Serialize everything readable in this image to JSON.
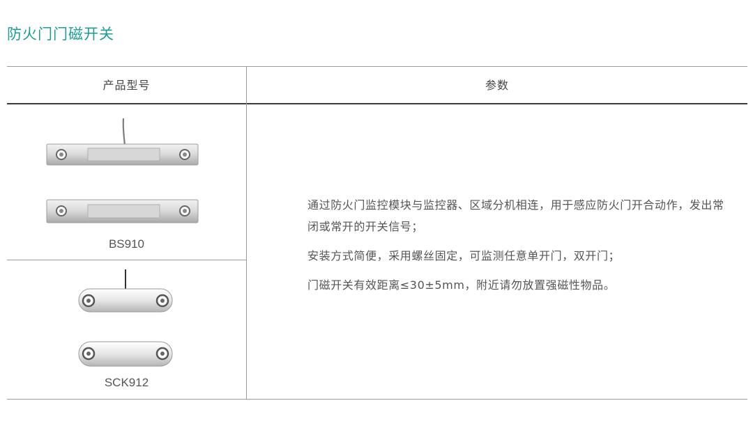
{
  "page": {
    "title": "防火门门磁开关"
  },
  "table": {
    "headers": {
      "model": "产品型号",
      "params": "参数"
    },
    "products": [
      {
        "model": "BS910",
        "image": "bs910-magnetic-switch-image"
      },
      {
        "model": "SCK912",
        "image": "sck912-magnetic-switch-image"
      }
    ],
    "params": [
      "通过防火门监控模块与监控器、区域分机相连，用于感应防火门开合动作，发出常闭或常开的开关信号；",
      "安装方式简便，采用螺丝固定，可监测任意单开门，双开门；",
      "门磁开关有效距离≤30±5mm，附近请勿放置强磁性物品。"
    ]
  },
  "colors": {
    "title": "#1a9e94",
    "header_rule": "#3a3a3a",
    "rule": "#9a9a9a",
    "text": "#555555"
  }
}
